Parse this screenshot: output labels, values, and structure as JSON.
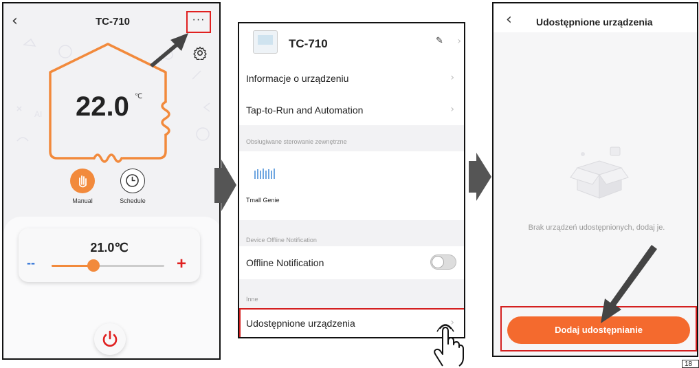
{
  "panel1": {
    "title": "TC-710",
    "more_glyph": "···",
    "current_temp": "22.0",
    "temp_unit": "℃",
    "modes": [
      {
        "label": "Manual"
      },
      {
        "label": "Schedule"
      }
    ],
    "set_temp": "21.0℃",
    "minus_glyph": "--",
    "plus_glyph": "+",
    "slider_fraction": 0.37
  },
  "panel2": {
    "device_name": "TC-710",
    "rows": {
      "info": "Informacje o urządzeniu",
      "tap_to_run": "Tap-to-Run and Automation",
      "tmall": "Tmall Genie",
      "offline": "Offline Notification",
      "shared": "Udostępnione urządzenia"
    },
    "sections": {
      "external": "Obsługiwane sterowanie zewnętrzne",
      "offline": "Device Offline Notification",
      "other": "Inne"
    },
    "offline_toggle": false
  },
  "panel3": {
    "title": "Udostępnione urządzenia",
    "empty_message": "Brak urządzeń udostępnionych, dodaj je.",
    "add_button": "Dodaj udostępnianie"
  },
  "page_number": "18",
  "colors": {
    "accent": "#f46a2e",
    "highlight": "#d42020",
    "slider_minus": "#2a6fd6",
    "slider_plus": "#e02020",
    "arrow": "#444444"
  }
}
